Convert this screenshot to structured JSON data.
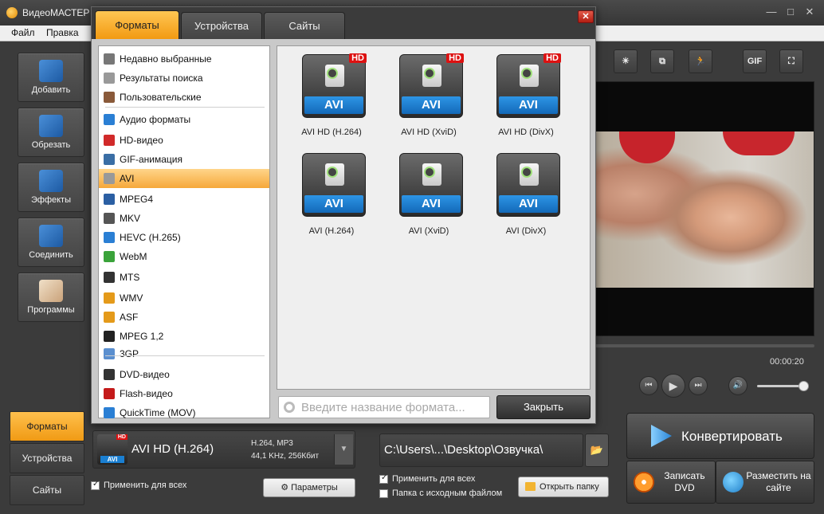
{
  "window": {
    "title": "ВидеоМАСТЕР",
    "minimize": "—",
    "maximize": "□",
    "close": "✕"
  },
  "menu": {
    "file": "Файл",
    "edit": "Правка"
  },
  "sidebar": [
    {
      "label": "Добавить",
      "icon": "film-add-icon",
      "color": "#2e8f3b"
    },
    {
      "label": "Обрезать",
      "icon": "scissors-icon",
      "color": "#c44"
    },
    {
      "label": "Эффекты",
      "icon": "magic-wand-icon",
      "color": "#d99a1e"
    },
    {
      "label": "Соединить",
      "icon": "film-join-icon",
      "color": "#3a78c4"
    },
    {
      "label": "Программы",
      "icon": "programs-icon",
      "color": "#caa"
    }
  ],
  "bottom_tabs": [
    "Форматы",
    "Устройства",
    "Сайты"
  ],
  "tools": {
    "gif": "GIF"
  },
  "player": {
    "time": "00:00:20"
  },
  "dialog": {
    "tabs": [
      "Форматы",
      "Устройства",
      "Сайты"
    ],
    "close": "✕",
    "categories": [
      {
        "label": "Недавно выбранные",
        "icon": "recent-icon",
        "color": "#777"
      },
      {
        "label": "Результаты поиска",
        "icon": "search-results-icon",
        "color": "#999"
      },
      {
        "label": "Пользовательские",
        "icon": "user-icon",
        "color": "#8a5a3a"
      },
      {
        "label": "Аудио форматы",
        "icon": "music-note-icon",
        "color": "#2a7fd4"
      },
      {
        "label": "HD-видео",
        "icon": "hd-icon",
        "color": "#d12a2a"
      },
      {
        "label": "GIF-анимация",
        "icon": "gif-icon",
        "color": "#3a6ea5"
      },
      {
        "label": "AVI",
        "icon": "avi-icon",
        "color": "#999"
      },
      {
        "label": "MPEG4",
        "icon": "mpeg4-icon",
        "color": "#2b5fa3"
      },
      {
        "label": "MKV",
        "icon": "mkv-icon",
        "color": "#555"
      },
      {
        "label": "HEVC (H.265)",
        "icon": "hevc-icon",
        "color": "#2a7fd4"
      },
      {
        "label": "WebM",
        "icon": "webm-icon",
        "color": "#3aa33a"
      },
      {
        "label": "MTS",
        "icon": "mts-icon",
        "color": "#333"
      },
      {
        "label": "WMV",
        "icon": "wmv-icon",
        "color": "#e49a1a"
      },
      {
        "label": "ASF",
        "icon": "asf-icon",
        "color": "#e49a1a"
      },
      {
        "label": "MPEG 1,2",
        "icon": "mpeg12-icon",
        "color": "#222"
      },
      {
        "label": "3GP",
        "icon": "phone-icon",
        "color": "#5a8fcf"
      },
      {
        "label": "DVD-видео",
        "icon": "dvd-icon",
        "color": "#333"
      },
      {
        "label": "Flash-видео",
        "icon": "flash-icon",
        "color": "#c41a1a"
      },
      {
        "label": "QuickTime (MOV)",
        "icon": "quicktime-icon",
        "color": "#2a7fd4"
      }
    ],
    "selected_category": "AVI",
    "formats": [
      {
        "label": "AVI HD (H.264)",
        "badge": "HD",
        "name": "AVI"
      },
      {
        "label": "AVI HD (XviD)",
        "badge": "HD",
        "name": "AVI"
      },
      {
        "label": "AVI HD (DivX)",
        "badge": "HD",
        "name": "AVI"
      },
      {
        "label": "AVI (H.264)",
        "badge": "",
        "name": "AVI"
      },
      {
        "label": "AVI (XviD)",
        "badge": "",
        "name": "AVI"
      },
      {
        "label": "AVI (DivX)",
        "badge": "",
        "name": "AVI"
      }
    ],
    "search_placeholder": "Введите название формата...",
    "close_button": "Закрыть"
  },
  "output_format": {
    "badge": "HD",
    "icon_text": "AVI",
    "name": "AVI HD (H.264)",
    "codecs": "H.264, MP3",
    "params": "44,1 KHz, 256Кбит",
    "apply_all": "Применить для всех",
    "params_button": "Параметры"
  },
  "output_path": {
    "path": "C:\\Users\\...\\Desktop\\Озвучка\\",
    "apply_all": "Применить для всех",
    "source_folder": "Папка с исходным файлом",
    "open_folder": "Открыть папку"
  },
  "actions": {
    "convert": "Конвертировать",
    "burn_dvd": "Записать DVD",
    "publish": "Разместить на сайте"
  },
  "colors": {
    "accent": "#f29a12",
    "dark": "#3b3b3b",
    "blue": "#1a7fd1"
  }
}
